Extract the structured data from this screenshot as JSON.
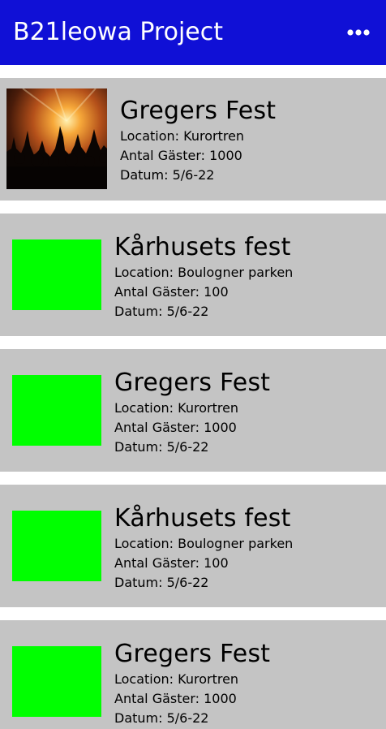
{
  "app": {
    "title": "B21leowa Project",
    "menu_icon": "more-horizontal-icon",
    "header_color": "#1010d6"
  },
  "events": [
    {
      "title": "Gregers Fest",
      "location": "Location: Kurortren",
      "guests": "Antal Gäster: 1000",
      "date": "Datum:  5/6-22",
      "image": "concert-crowd-photo"
    },
    {
      "title": "Kårhusets fest",
      "location": "Location: Boulogner parken",
      "guests": "Antal Gäster: 100",
      "date": "Datum:  5/6-22",
      "image": "green-placeholder"
    },
    {
      "title": "Gregers Fest",
      "location": "Location: Kurortren",
      "guests": "Antal Gäster: 1000",
      "date": "Datum:  5/6-22",
      "image": "green-placeholder"
    },
    {
      "title": "Kårhusets fest",
      "location": "Location: Boulogner parken",
      "guests": "Antal Gäster: 100",
      "date": "Datum:  5/6-22",
      "image": "green-placeholder"
    },
    {
      "title": "Gregers Fest",
      "location": "Location: Kurortren",
      "guests": "Antal Gäster: 1000",
      "date": "Datum:  5/6-22",
      "image": "green-placeholder"
    }
  ]
}
